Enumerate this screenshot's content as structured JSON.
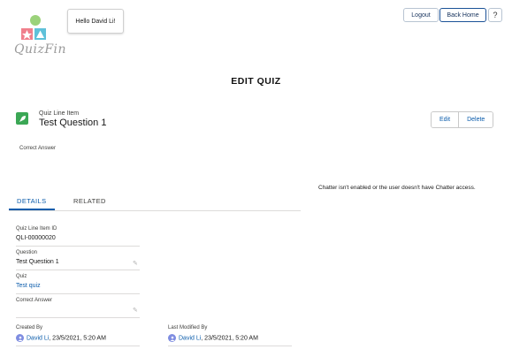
{
  "brand": {
    "name": "QuizFin"
  },
  "header": {
    "greeting": "Hello David Li!",
    "logout_label": "Logout",
    "back_home_label": "Back Home",
    "help_label": "?"
  },
  "page": {
    "title": "EDIT QUIZ"
  },
  "record": {
    "object_label": "Quiz Line Item",
    "title": "Test Question 1",
    "edit_label": "Edit",
    "delete_label": "Delete",
    "correct_answer_label": "Correct Answer"
  },
  "chatter": {
    "message": "Chatter isn't enabled or the user doesn't have Chatter access."
  },
  "tabs": [
    {
      "label": "DETAILS",
      "active": true
    },
    {
      "label": "RELATED",
      "active": false
    }
  ],
  "fields": [
    {
      "label": "Quiz Line Item ID",
      "value": "QLI-00000020"
    },
    {
      "label": "Question",
      "value": "Test Question 1"
    },
    {
      "label": "Quiz",
      "value": "Test quiz"
    },
    {
      "label": "Correct Answer",
      "value": ""
    }
  ],
  "created": {
    "label": "Created By",
    "user": "David Li",
    "date": ", 23/5/2021, 5:20 AM"
  },
  "modified": {
    "label": "Last Modified By",
    "user": "David Li",
    "date": ", 23/5/2021, 5:20 AM"
  },
  "colors": {
    "accent": "#0b5cab",
    "record_icon": "#3ba755",
    "avatar": "#7f8de1"
  }
}
